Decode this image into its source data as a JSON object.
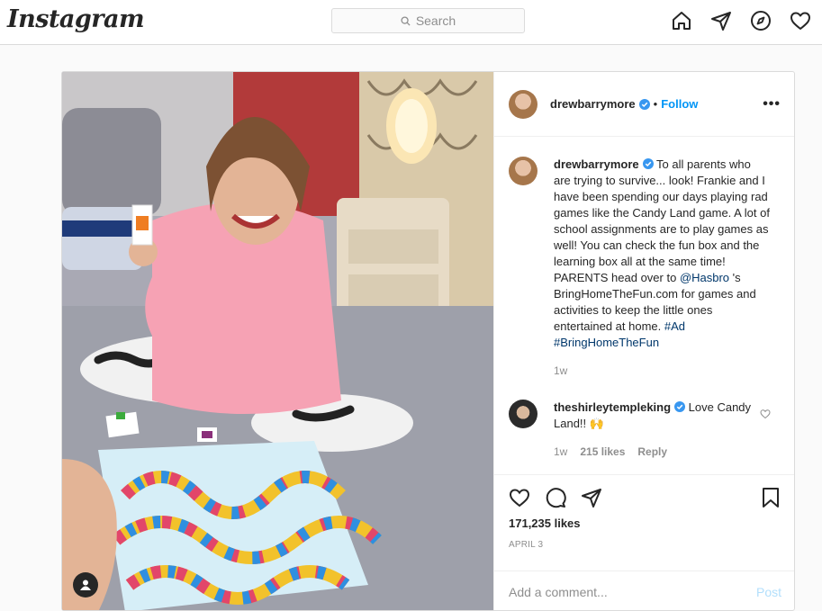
{
  "nav": {
    "logo": "Instagram",
    "search_placeholder": "Search",
    "icons": [
      "home-icon",
      "direct-icon",
      "explore-icon",
      "activity-heart-icon"
    ]
  },
  "post": {
    "author": "drewbarrymore",
    "follow_label": "Follow",
    "dot": "•",
    "more_label": "•••",
    "caption": {
      "author": "drewbarrymore",
      "text_1": " To all parents who are trying to survive... look! Frankie and I have been spending our days playing rad games like the Candy Land game. A lot of school assignments are to play games as well! You can check the fun box and the learning box all at the same time! PARENTS head over to ",
      "mention": "@Hasbro",
      "text_2": " 's BringHomeTheFun.com for games and activities to keep the little ones entertained at home. ",
      "hashtag_1": "#Ad",
      "hashtag_2": "#BringHomeTheFun",
      "time": "1w"
    },
    "comment": {
      "author": "theshirleytempleking",
      "text": " Love Candy Land!! 🙌",
      "time": "1w",
      "likes": "215 likes",
      "reply_label": "Reply"
    },
    "likes": "171,235 likes",
    "date": "APRIL 3",
    "add_comment_placeholder": "Add a comment...",
    "post_button": "Post"
  },
  "colors": {
    "link_blue": "#0095f6",
    "verified_blue": "#3897f0",
    "border": "#dbdbdb"
  }
}
